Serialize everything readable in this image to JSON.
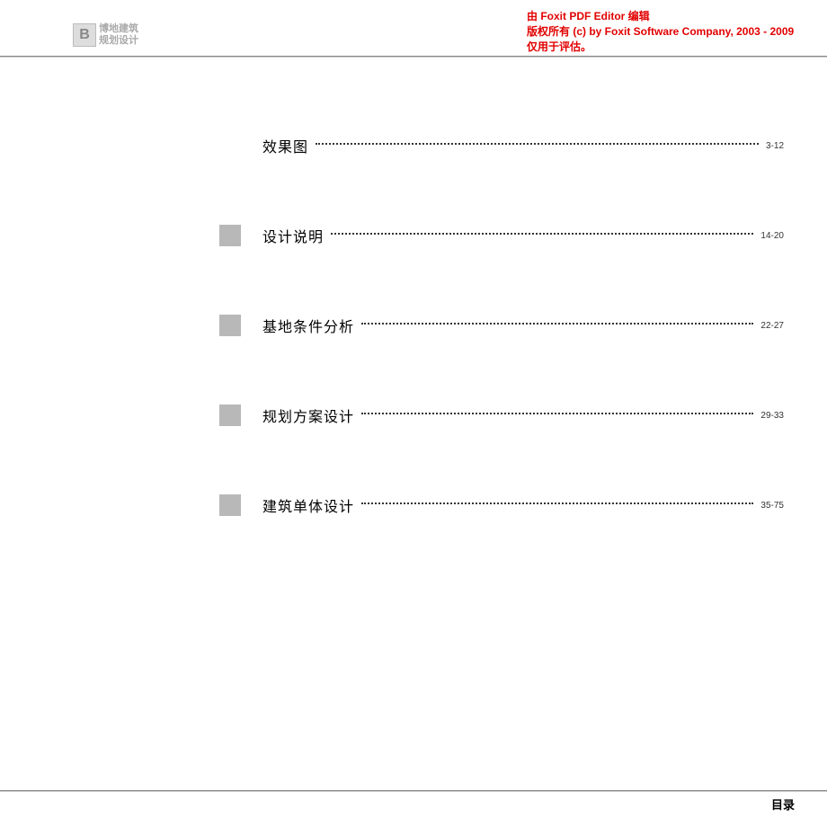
{
  "logo": {
    "mark": "B",
    "line1": "博地建筑",
    "line2": "规划设计"
  },
  "watermark": {
    "line1": "由 Foxit PDF Editor 编辑",
    "line2": "版权所有 (c) by Foxit Software Company, 2003 - 2009",
    "line3": "仅用于评估。"
  },
  "toc": {
    "items": [
      {
        "title": "效果图",
        "pages": "3-12",
        "bullet": false
      },
      {
        "title": "设计说明",
        "pages": "14-20",
        "bullet": true
      },
      {
        "title": "基地条件分析",
        "pages": "22-27",
        "bullet": true
      },
      {
        "title": "规划方案设计",
        "pages": "29-33",
        "bullet": true
      },
      {
        "title": "建筑单体设计",
        "pages": "35-75",
        "bullet": true
      }
    ]
  },
  "footer": {
    "label": "目录"
  }
}
